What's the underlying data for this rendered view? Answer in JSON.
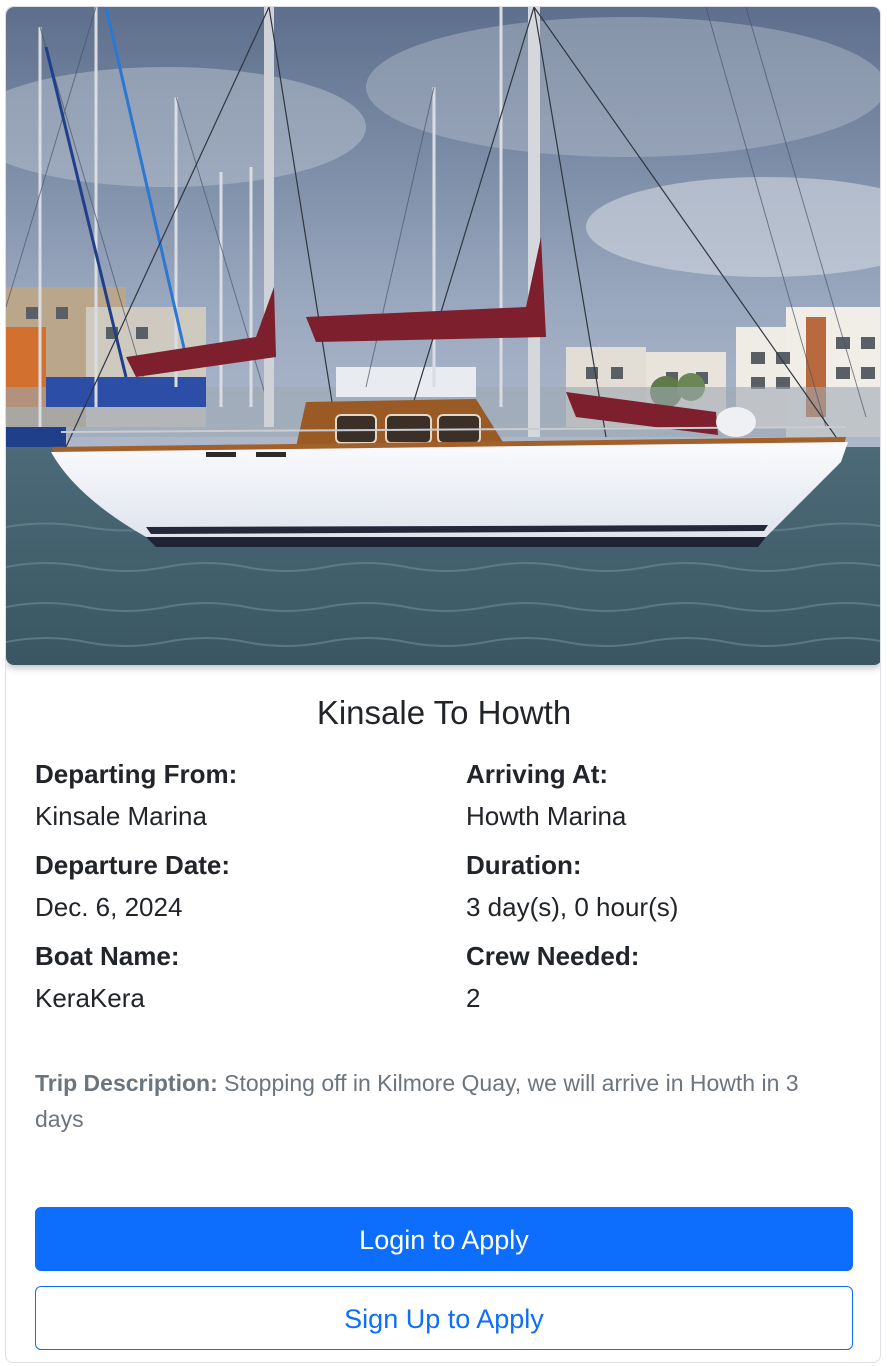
{
  "trip": {
    "image_alt": "Sailboat moored in marina",
    "title": "Kinsale To Howth",
    "details": {
      "departing_from": {
        "label": "Departing From:",
        "value": "Kinsale Marina"
      },
      "arriving_at": {
        "label": "Arriving At:",
        "value": "Howth Marina"
      },
      "departure_date": {
        "label": "Departure Date:",
        "value": "Dec. 6, 2024"
      },
      "duration": {
        "label": "Duration:",
        "value": "3 day(s), 0 hour(s)"
      },
      "boat_name": {
        "label": "Boat Name:",
        "value": "KeraKera"
      },
      "crew_needed": {
        "label": "Crew Needed:",
        "value": "2"
      }
    },
    "description": {
      "label": "Trip Description:",
      "text": "Stopping off in Kilmore Quay, we will arrive in Howth in 3 days"
    }
  },
  "actions": {
    "login_label": "Login to Apply",
    "signup_label": "Sign Up to Apply"
  },
  "colors": {
    "primary": "#0d6efd",
    "text": "#212529",
    "muted": "#6c757d"
  }
}
